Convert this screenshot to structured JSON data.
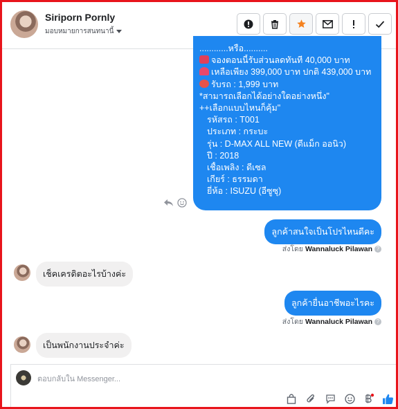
{
  "header": {
    "contact_name": "Siriporn Pornly",
    "assign_label": "มอบหมายการสนทนานี้",
    "actions": [
      "spam-icon",
      "trash-icon",
      "star-icon",
      "mail-icon",
      "important-icon",
      "done-icon"
    ]
  },
  "offer_message": {
    "lines": [
      "............หรือ..........",
      "จองตอนนี้รับส่วนลดทันที 40,000 บาท",
      "เหลือเพียง 399,000 บาท ปกติ 439,000 บาท",
      "รับรถ : 1,999 บาท",
      "*สามารถเลือกได้อย่างใดอย่างหนึ่ง\"",
      "++เลือกแบบไหนก็คุ้ม\"",
      "รหัสรถ : T001",
      "ประเภท : กระบะ",
      "รุ่น : D-MAX ALL NEW (ดีแม็ก ออนิว)",
      "ปี : 2018",
      "เชื้อเพลิง : ดีเซล",
      "เกียร์ : ธรรมดา",
      "ยี่ห้อ : ISUZU (อีซูซุ)"
    ],
    "emoji": [
      "car-emoji",
      "ribbon-emoji",
      "pushpin-emoji"
    ]
  },
  "messages": [
    {
      "dir": "out",
      "text": "ลูกค้าสนใจเป็นโปรไหนดีคะ",
      "sender_prefix": "ส่งโดย",
      "sender_name": "Wannaluck Pilawan"
    },
    {
      "dir": "in",
      "text": "เช็คเครดิตอะไรบ้างค่ะ"
    },
    {
      "dir": "out",
      "text": "ลูกค้ายื่นอาชีพอะไรคะ",
      "sender_prefix": "ส่งโดย",
      "sender_name": "Wannaluck Pilawan"
    },
    {
      "dir": "in",
      "text": "เป็นพนักงานประจำค่ะ"
    }
  ],
  "composer": {
    "placeholder": "ตอบกลับใน Messenger...",
    "tools": [
      "bag-icon",
      "attach-icon",
      "saved-reply-icon",
      "emoji-icon",
      "payment-icon",
      "like-icon"
    ]
  },
  "colors": {
    "accent": "#1e87f0",
    "frame": "#e8141b",
    "star": "#f5821f"
  }
}
